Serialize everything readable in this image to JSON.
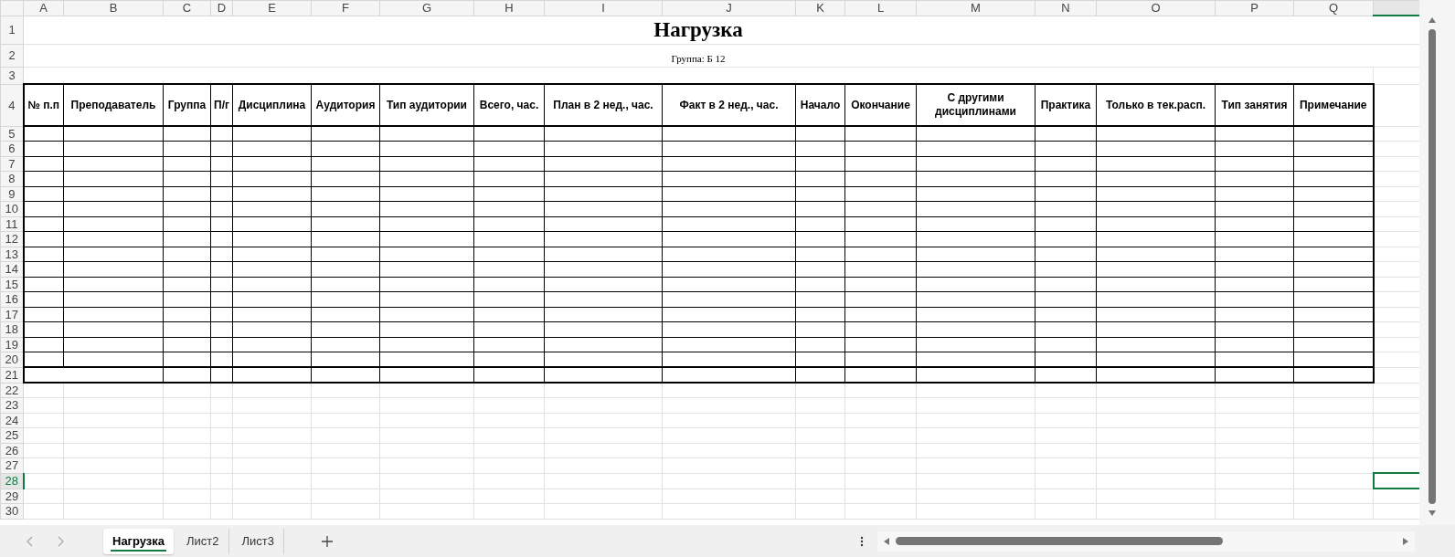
{
  "column_letters": [
    "A",
    "B",
    "C",
    "D",
    "E",
    "F",
    "G",
    "H",
    "I",
    "J",
    "K",
    "L",
    "M",
    "N",
    "O",
    "P",
    "Q"
  ],
  "row_numbers": [
    {
      "label": "1",
      "selected": false
    },
    {
      "label": "2",
      "selected": false
    },
    {
      "label": "3",
      "selected": false
    },
    {
      "label": "4",
      "selected": false
    },
    {
      "label": "5",
      "selected": false
    },
    {
      "label": "6",
      "selected": false
    },
    {
      "label": "7",
      "selected": false
    },
    {
      "label": "8",
      "selected": false
    },
    {
      "label": "9",
      "selected": false
    },
    {
      "label": "10",
      "selected": false
    },
    {
      "label": "11",
      "selected": false
    },
    {
      "label": "12",
      "selected": false
    },
    {
      "label": "13",
      "selected": false
    },
    {
      "label": "14",
      "selected": false
    },
    {
      "label": "15",
      "selected": false
    },
    {
      "label": "16",
      "selected": false
    },
    {
      "label": "17",
      "selected": false
    },
    {
      "label": "18",
      "selected": false
    },
    {
      "label": "19",
      "selected": false
    },
    {
      "label": "20",
      "selected": false
    },
    {
      "label": "21",
      "selected": false
    },
    {
      "label": "22",
      "selected": false
    },
    {
      "label": "23",
      "selected": false
    },
    {
      "label": "24",
      "selected": false
    },
    {
      "label": "25",
      "selected": false
    },
    {
      "label": "26",
      "selected": false
    },
    {
      "label": "27",
      "selected": false
    },
    {
      "label": "28",
      "selected": true
    },
    {
      "label": "29",
      "selected": false
    },
    {
      "label": "30",
      "selected": false
    }
  ],
  "title": "Нагрузка",
  "subtitle": "Группа: Б 12",
  "table": {
    "columns": [
      "№ п.п",
      "Преподаватель",
      "Группа",
      "П/г",
      "Дисциплина",
      "Аудитория",
      "Тип аудитории",
      "Всего, час.",
      "План в 2 нед., час.",
      "Факт в 2 нед., час.",
      "Начало",
      "Окончание",
      "С другими дисциплинами",
      "Практика",
      "Только в тек.расп.",
      "Тип занятия",
      "Примечание"
    ]
  },
  "sheet_tabs": [
    {
      "label": "Нагрузка",
      "selected": true
    },
    {
      "label": "Лист2",
      "selected": false
    },
    {
      "label": "Лист3",
      "selected": false
    }
  ]
}
